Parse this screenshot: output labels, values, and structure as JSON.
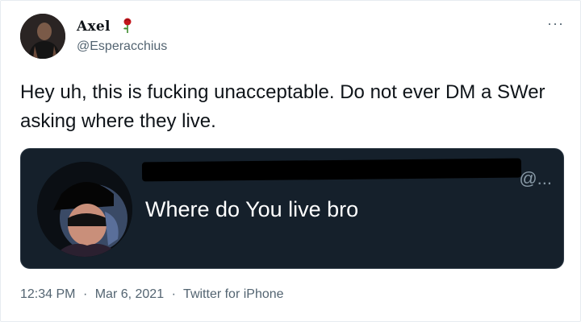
{
  "tweet": {
    "author_name": "Axel",
    "author_handle": "@Esperacchius",
    "more_label": "···",
    "text": "Hey uh, this is fucking unacceptable. Do not ever DM a SWer asking where they live.",
    "media": {
      "dm_handle_fragment": "@...",
      "dm_message": "Where do You live bro"
    },
    "time": "12:34 PM",
    "separator": "·",
    "date": "Mar 6, 2021",
    "source": "Twitter for iPhone"
  },
  "icons": {
    "avatar": "user-avatar",
    "rose": "rose-emoji-icon",
    "more": "more-options-icon"
  },
  "colors": {
    "text": "#0f1419",
    "secondary": "#536471",
    "media_bg": "#15202b"
  }
}
